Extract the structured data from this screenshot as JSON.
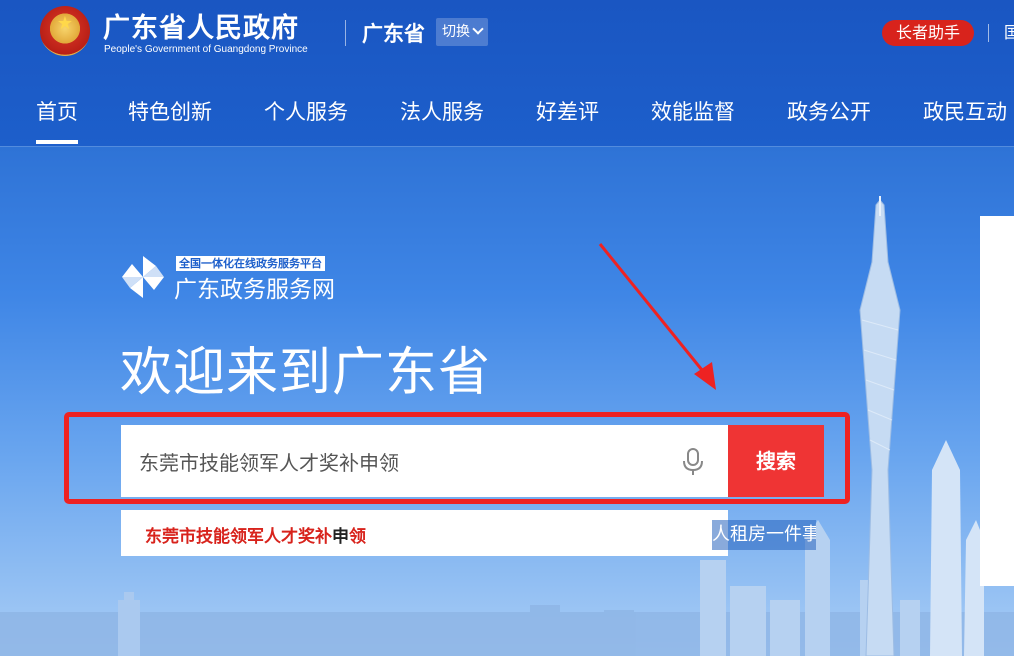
{
  "header": {
    "site_title": "广东省人民政府",
    "site_subtitle": "People's Government of Guangdong Province",
    "region": "广东省",
    "switch_label": "切换",
    "elder_mode": "长者助手",
    "clipped_link": "国"
  },
  "nav": {
    "items": [
      {
        "label": "首页",
        "active": true
      },
      {
        "label": "特色创新"
      },
      {
        "label": "个人服务"
      },
      {
        "label": "法人服务"
      },
      {
        "label": "好差评"
      },
      {
        "label": "效能监督"
      },
      {
        "label": "政务公开"
      },
      {
        "label": "政民互动"
      }
    ]
  },
  "hero": {
    "platform_badge": "全国一体化在线政务服务平台",
    "platform_name": "广东政务服务网",
    "welcome": "欢迎来到广东省"
  },
  "search": {
    "value": "东莞市技能领军人才奖补申领",
    "button": "搜索",
    "suggestion_parts": [
      "东莞市技能领军人才奖补",
      "申",
      "领"
    ],
    "hot_tag": "人租房一件事"
  },
  "colors": {
    "brand_blue": "#1d5fcb",
    "alert_red": "#d8231c",
    "search_red": "#ef3434",
    "annotation_red": "#ee2222"
  }
}
